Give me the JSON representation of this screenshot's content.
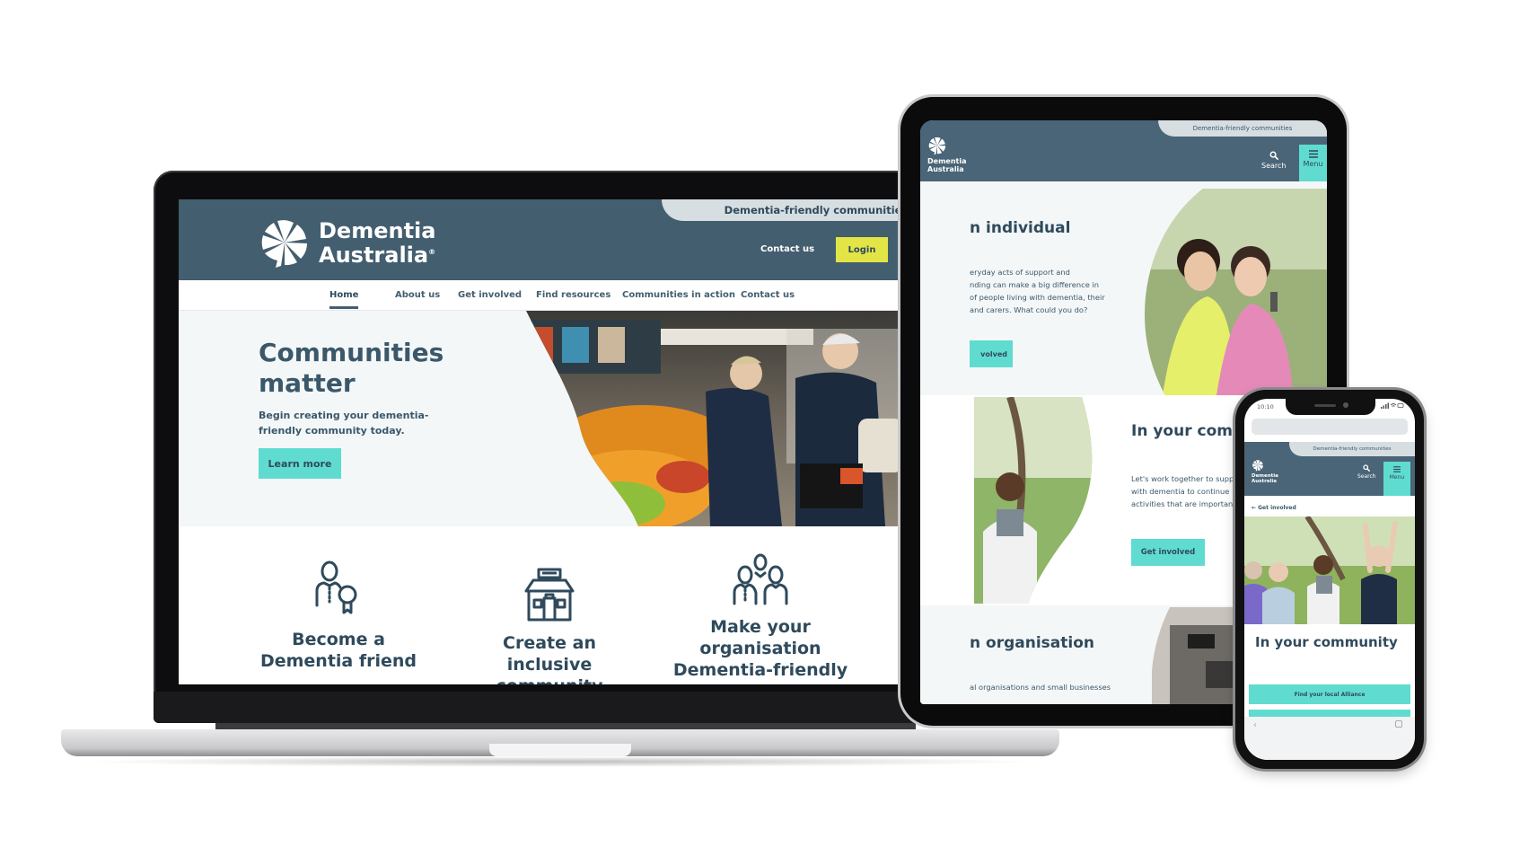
{
  "brand": {
    "name_line1": "Dementia",
    "name_line2": "Australia",
    "registered": "®",
    "section_tag": "Dementia-friendly communities",
    "colors": {
      "header": "#435e6f",
      "teal_accent": "#5fdccf",
      "login_yellow": "#e2e545",
      "text_dark": "#2f4a5c",
      "tag_bar": "#d6dee2"
    }
  },
  "laptop": {
    "header": {
      "contact_label": "Contact us",
      "login_label": "Login",
      "search_icon": "search-icon"
    },
    "nav": [
      {
        "label": "Home",
        "active": true
      },
      {
        "label": "About us",
        "active": false
      },
      {
        "label": "Get involved",
        "active": false
      },
      {
        "label": "Find resources",
        "active": false
      },
      {
        "label": "Communities in action",
        "active": false
      },
      {
        "label": "Contact us",
        "active": false
      }
    ],
    "hero": {
      "title": "Communities matter",
      "subtitle": "Begin creating your dementia-friendly community today.",
      "button_label": "Learn more",
      "image": "older couple shopping for fruit in supermarket"
    },
    "cards": [
      {
        "icon": "person-with-badge-icon",
        "title": "Become a Dementia friend"
      },
      {
        "icon": "shop-building-icon",
        "title": "Create an inclusive community"
      },
      {
        "icon": "group-of-people-icon",
        "title": "Make your organisation Dementia-friendly"
      }
    ]
  },
  "tablet": {
    "header": {
      "search_label": "Search",
      "menu_label": "Menu"
    },
    "sections": [
      {
        "title": "n individual",
        "body": "eryday acts of support and nding can make a big difference in of people living with dementia, their and carers. What could you do?",
        "body_lines": [
          "eryday acts of support and",
          "nding can make a big difference in",
          "of people living with dementia, their",
          "and carers. What could you do?"
        ],
        "button_label": "volved"
      },
      {
        "title": "In your comm",
        "body_lines": [
          "Let's work together to supp",
          "with dementia to continue",
          "activities that are importan"
        ],
        "button_label": "Get involved"
      },
      {
        "title": "n organisation",
        "body": "al organisations and small businesses"
      }
    ]
  },
  "phone": {
    "status_time": "10:10",
    "header": {
      "search_label": "Search",
      "menu_label": "Menu"
    },
    "back_link": "Get involved",
    "title": "In your community",
    "button_label": "Find your local Alliance"
  }
}
